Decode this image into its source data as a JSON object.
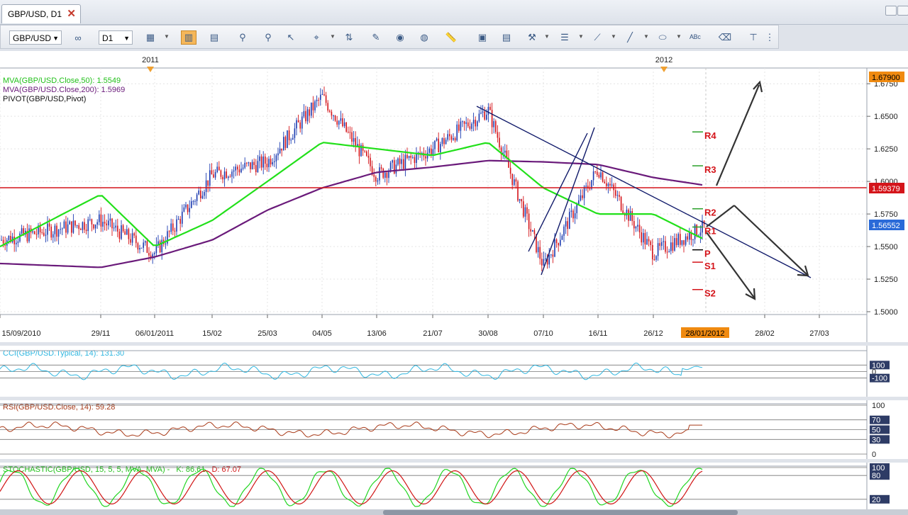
{
  "tab": {
    "title": "GBP/USD, D1",
    "close": "✕"
  },
  "toolbar": {
    "symbol": "GBP/USD",
    "period": "D1"
  },
  "main": {
    "year_labels": [
      "2011",
      "2012"
    ],
    "indicators": [
      "MVA(GBP/USD.Close,50): 1.5549",
      "MVA(GBP/USD.Close,200): 1.5969",
      "PIVOT(GBP/USD,Pivot)"
    ],
    "price_ticks": [
      "1.6750",
      "1.6500",
      "1.6250",
      "1.6000",
      "1.5750",
      "1.5500",
      "1.5250",
      "1.5000"
    ],
    "price_badges": [
      "1.67900",
      "1.59379",
      "1.56552"
    ],
    "pivot_labels": [
      "R4",
      "R3",
      "R2",
      "R1",
      "P",
      "S1",
      "S2"
    ],
    "date_ticks": [
      "15/09/2010",
      "29/11",
      "06/01/2011",
      "15/02",
      "25/03",
      "04/05",
      "13/06",
      "21/07",
      "30/08",
      "07/10",
      "16/11",
      "26/12",
      "28/02",
      "27/03"
    ],
    "current_date": "28/01/2012"
  },
  "cci": {
    "title": "CCI(GBP/USD.Typical, 14): 131.30",
    "ticks": [
      "100",
      "0",
      "-100"
    ]
  },
  "rsi": {
    "title": "RSI(GBP/USD.Close, 14): 59.28",
    "ticks": [
      "100",
      "70",
      "50",
      "30",
      "0"
    ]
  },
  "stoch": {
    "title": "STOCHASTIC(GBP/USD, 15, 5, 5, MVA, MVA) -",
    "k": "K: 86.61",
    "d": "D: 67.07",
    "ticks": [
      "100",
      "80",
      "20"
    ]
  },
  "colors": {
    "mva50": "#22e01a",
    "mva200": "#6a1a7a",
    "hline": "#d4141a",
    "trend": "#101a6a",
    "bull": "#1a3ab0",
    "bear": "#d4141a",
    "cci": "#31b7e0",
    "rsi": "#a83a18",
    "stoch_k": "#22d622",
    "stoch_d": "#d11515"
  },
  "chart_data": {
    "type": "line",
    "title": "GBP/USD, D1",
    "x": [
      "15/09/2010",
      "29/11",
      "06/01/2011",
      "15/02",
      "25/03",
      "04/05",
      "13/06",
      "21/07",
      "30/08",
      "07/10",
      "16/11",
      "26/12",
      "28/01/2012"
    ],
    "series": [
      {
        "name": "GBP/USD.Close",
        "values": [
          1.555,
          1.57,
          1.545,
          1.605,
          1.615,
          1.665,
          1.605,
          1.625,
          1.655,
          1.535,
          1.61,
          1.545,
          1.5655
        ]
      },
      {
        "name": "MVA(GBP/USD.Close,50)",
        "values": [
          1.55,
          1.59,
          1.55,
          1.57,
          1.6,
          1.63,
          1.625,
          1.62,
          1.63,
          1.595,
          1.575,
          1.575,
          1.5549
        ]
      },
      {
        "name": "MVA(GBP/USD.Close,200)",
        "values": [
          1.537,
          1.534,
          1.542,
          1.555,
          1.578,
          1.595,
          1.607,
          1.611,
          1.616,
          1.615,
          1.613,
          1.603,
          1.5969
        ]
      }
    ],
    "pivots": {
      "R4": 1.638,
      "R3": 1.612,
      "R2": 1.579,
      "R1": 1.565,
      "P": 1.5475,
      "S1": 1.538,
      "S2": 1.517
    },
    "horizontal_line": 1.59379,
    "ylim": [
      1.5,
      1.68
    ],
    "grid": true,
    "cci_last": 131.3,
    "rsi_last": 59.28,
    "stoch_k": 86.61,
    "stoch_d": 67.07
  }
}
